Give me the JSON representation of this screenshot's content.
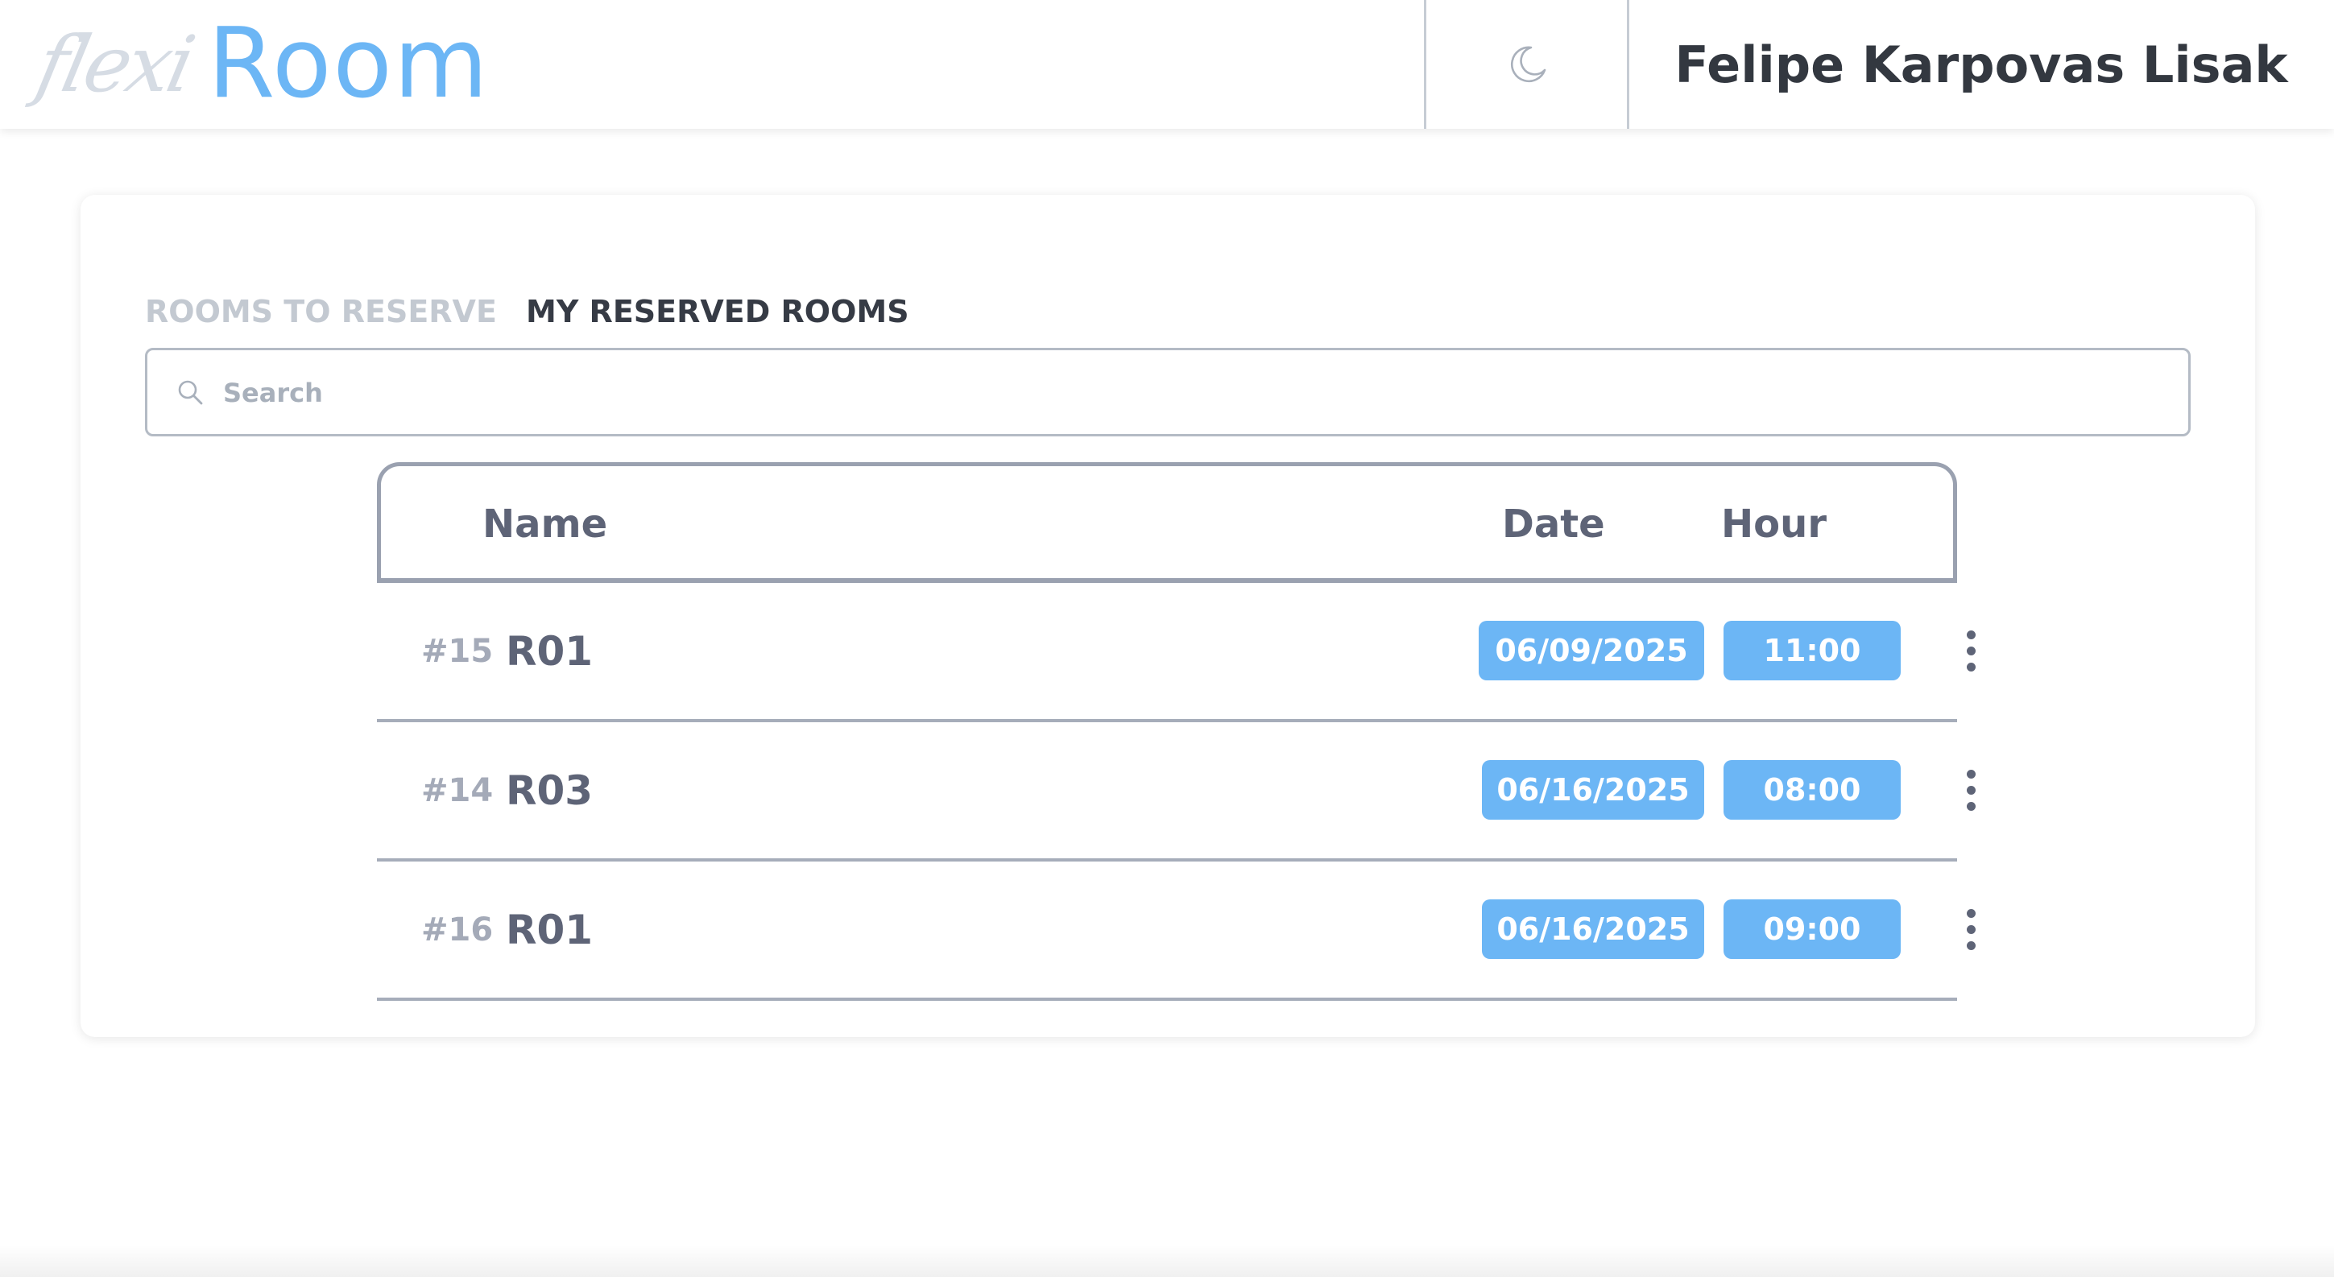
{
  "header": {
    "logo_script": "flexi",
    "logo_main": "Room",
    "user_name": "Felipe Karpovas Lisak"
  },
  "tabs": [
    {
      "label": "ROOMS TO RESERVE",
      "active": false
    },
    {
      "label": "MY RESERVED ROOMS",
      "active": true
    }
  ],
  "search": {
    "placeholder": "Search",
    "value": ""
  },
  "table": {
    "columns": [
      "Name",
      "Date",
      "Hour"
    ],
    "rows": [
      {
        "id": "#15",
        "name": "R01",
        "date": "06/09/2025",
        "hour": "11:00"
      },
      {
        "id": "#14",
        "name": "R03",
        "date": "06/16/2025",
        "hour": "08:00"
      },
      {
        "id": "#16",
        "name": "R01",
        "date": "06/16/2025",
        "hour": "09:00"
      }
    ]
  },
  "colors": {
    "accent": "#6cb6f5",
    "text_dark": "#363b45",
    "text_muted": "#a4aab8"
  }
}
